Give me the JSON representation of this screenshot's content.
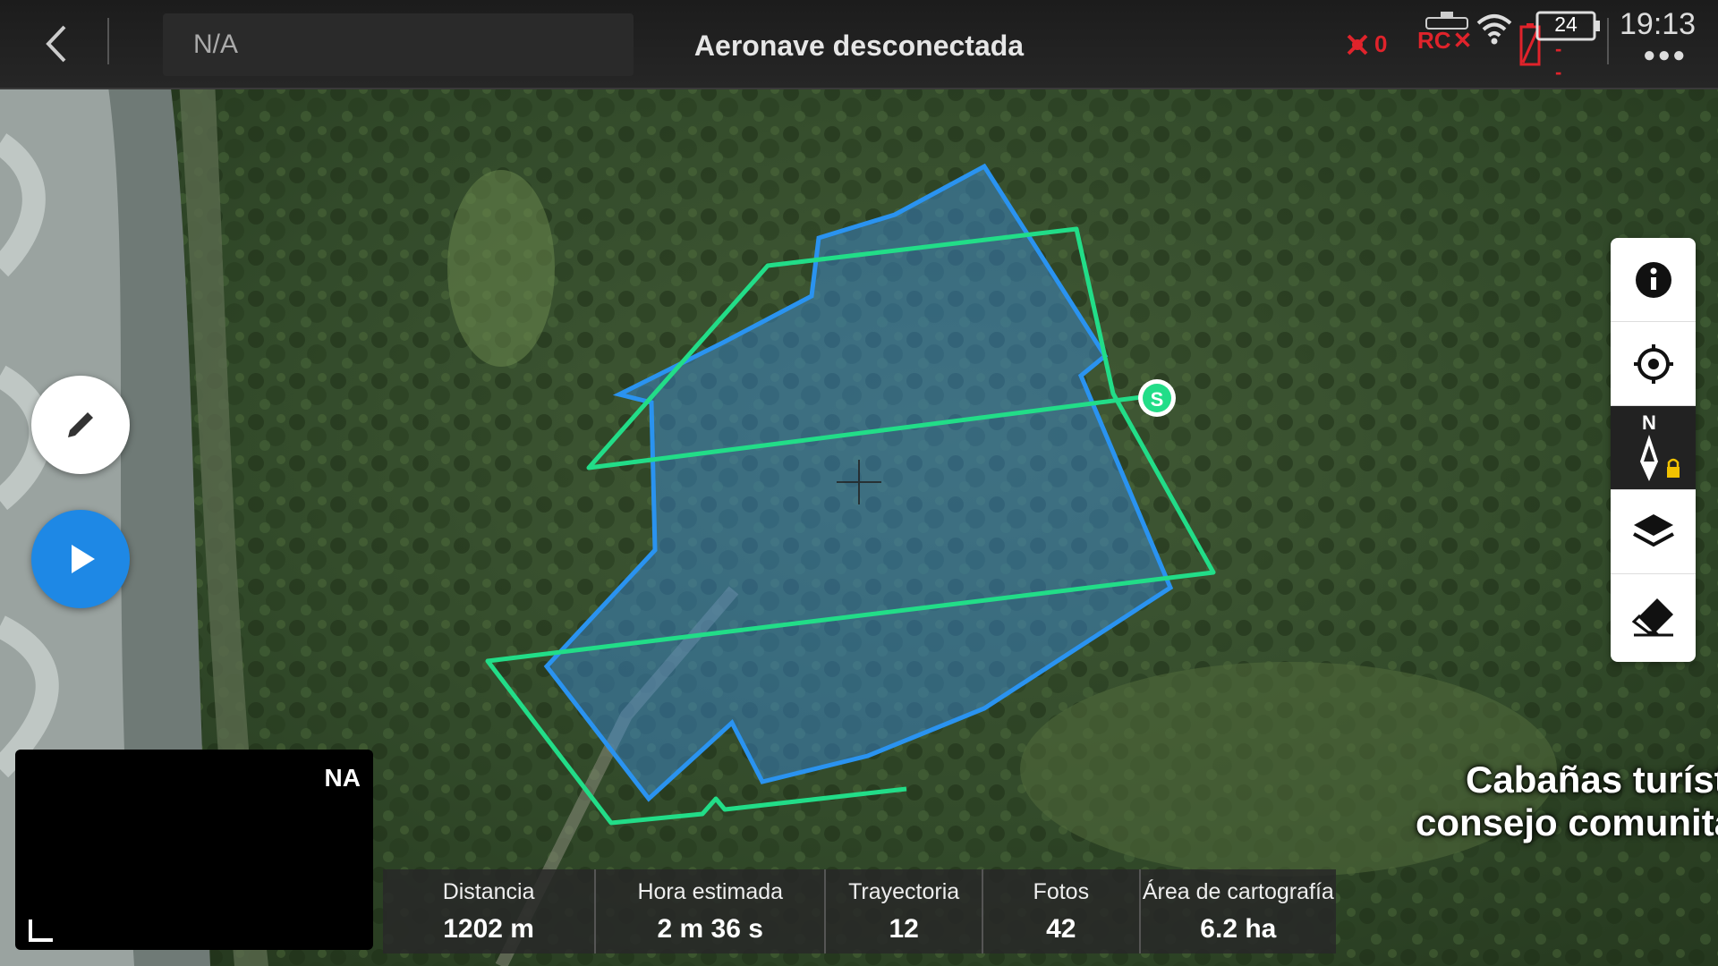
{
  "header": {
    "plan_name_placeholder": "N/A",
    "status_title": "Aeronave desconectada",
    "obstacle_count": "0",
    "rc_label": "RC",
    "battery_level": "24",
    "aircraft_battery": "--",
    "time": "19:13"
  },
  "map": {
    "labels": [
      "Cabañas turíst",
      "consejo comunita"
    ],
    "start_marker": "S"
  },
  "camera": {
    "label": "NA"
  },
  "stats": [
    {
      "label": "Distancia",
      "value": "1202 m"
    },
    {
      "label": "Hora estimada",
      "value": "2 m 36 s"
    },
    {
      "label": "Trayectoria",
      "value": "12"
    },
    {
      "label": "Fotos",
      "value": "42"
    },
    {
      "label": "Área de cartografía",
      "value": "6.2 ha"
    }
  ],
  "toolbar": [
    "info-icon",
    "locate-icon",
    "compass-icon",
    "layers-icon",
    "eraser-icon"
  ],
  "colors": {
    "flight_path": "#22dd88",
    "survey_area_fill": "#3c8fe0",
    "survey_area_stroke": "#2a93f0",
    "play_button": "#1e88e5",
    "warning_red": "#e0232b"
  }
}
